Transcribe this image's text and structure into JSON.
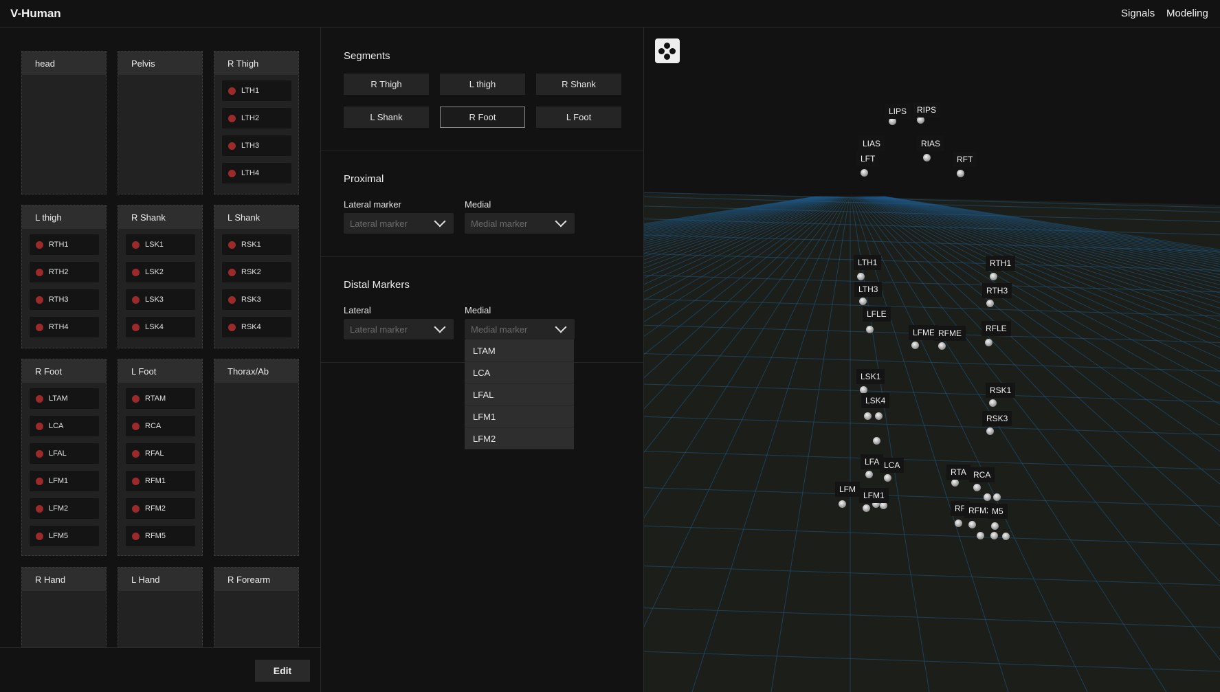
{
  "app": {
    "title": "V-Human"
  },
  "nav": {
    "signals": "Signals",
    "modeling": "Modeling"
  },
  "segment_cards": [
    {
      "title": "head",
      "markers": []
    },
    {
      "title": "Pelvis",
      "markers": []
    },
    {
      "title": "R Thigh",
      "markers": [
        "LTH1",
        "LTH2",
        "LTH3",
        "LTH4"
      ]
    },
    {
      "title": "L thigh",
      "markers": [
        "RTH1",
        "RTH2",
        "RTH3",
        "RTH4"
      ]
    },
    {
      "title": "R Shank",
      "markers": [
        "LSK1",
        "LSK2",
        "LSK3",
        "LSK4"
      ]
    },
    {
      "title": "L Shank",
      "markers": [
        "RSK1",
        "RSK2",
        "RSK3",
        "RSK4"
      ]
    },
    {
      "title": "R Foot",
      "markers": [
        "LTAM",
        "LCA",
        "LFAL",
        "LFM1",
        "LFM2",
        "LFM5"
      ]
    },
    {
      "title": "L Foot",
      "markers": [
        "RTAM",
        "RCA",
        "RFAL",
        "RFM1",
        "RFM2",
        "RFM5"
      ]
    },
    {
      "title": "Thorax/Ab",
      "markers": []
    },
    {
      "title": "R Hand",
      "markers": []
    },
    {
      "title": "L Hand",
      "markers": []
    },
    {
      "title": "R Forearm",
      "markers": []
    }
  ],
  "footer": {
    "edit_label": "Edit"
  },
  "segments": {
    "title": "Segments",
    "buttons": [
      "R Thigh",
      "L thigh",
      "R Shank",
      "L Shank",
      "R Foot",
      "L Foot"
    ],
    "selected": "R Foot"
  },
  "proximal": {
    "title": "Proximal",
    "lateral_label": "Lateral marker",
    "lateral_placeholder": "Lateral marker",
    "medial_label": "Medial",
    "medial_placeholder": "Medial marker"
  },
  "distal": {
    "title": "Distal Markers",
    "lateral_label": "Lateral",
    "lateral_placeholder": "Lateral marker",
    "medial_label": "Medial",
    "medial_placeholder": "Medial marker",
    "options": [
      "LTAM",
      "LCA",
      "LFAL",
      "LFM1",
      "LFM2"
    ]
  },
  "viewport": {
    "marker_labels": [
      "LIPS",
      "RIPS",
      "LIAS",
      "RIAS",
      "LFT",
      "RFT",
      "LTH1",
      "RTH1",
      "LTH3",
      "RTH3",
      "LFLE",
      "LFME",
      "RFME",
      "RFLE",
      "LSK1",
      "RSK1",
      "LSK4",
      "RSK3",
      "LFA",
      "LCA",
      "RTA",
      "RCA",
      "LFM",
      "LFM1",
      "RF",
      "RFM2",
      "M5"
    ],
    "colors": {
      "grid": "#1f5a8a",
      "floor": "#1c1f19",
      "marker": "#d0d0d0"
    }
  },
  "colors": {
    "marker_dot": "#9c2a2a",
    "card": "#222222",
    "background": "#121212"
  }
}
